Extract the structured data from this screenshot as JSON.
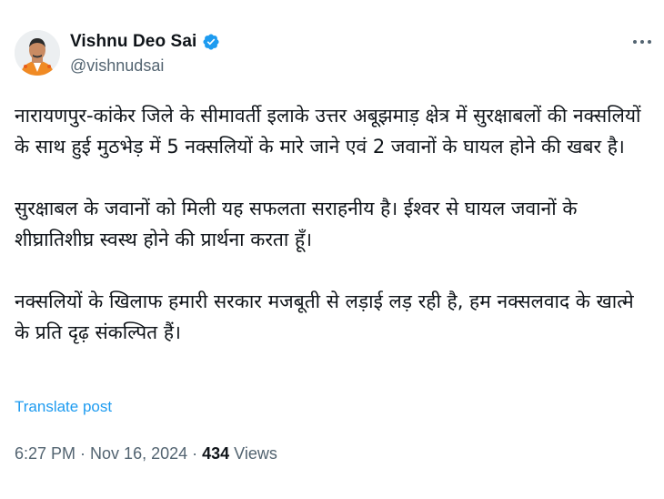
{
  "author": {
    "display_name": "Vishnu Deo Sai",
    "handle": "@vishnudsai",
    "verified_icon": "verified-badge-icon",
    "avatar_icon": "profile-photo"
  },
  "post": {
    "paragraphs": [
      "नारायणपुर-कांकेर जिले के सीमावर्ती इलाके उत्तर अबूझमाड़ क्षेत्र में सुरक्षाबलों की नक्सलियों के साथ हुई मुठभेड़ में 5 नक्सलियों के मारे जाने एवं 2 जवानों के घायल होने की खबर है।",
      "सुरक्षाबल के जवानों को मिली यह सफलता सराहनीय है। ईश्वर से घायल जवानों के शीघ्रातिशीघ्र स्वस्थ होने की प्रार्थना करता हूँ।",
      "नक्सलियों के खिलाफ हमारी सरकार मजबूती से लड़ाई लड़ रही है, हम नक्सलवाद के खात्मे के प्रति दृढ़ संकल्पित हैं।"
    ],
    "translate_label": "Translate post"
  },
  "meta": {
    "time": "6:27 PM",
    "separator": "·",
    "date": "Nov 16, 2024",
    "views_count": "434",
    "views_label": "Views"
  },
  "colors": {
    "accent": "#1d9bf0",
    "text_primary": "#0f1419",
    "text_secondary": "#536471"
  }
}
